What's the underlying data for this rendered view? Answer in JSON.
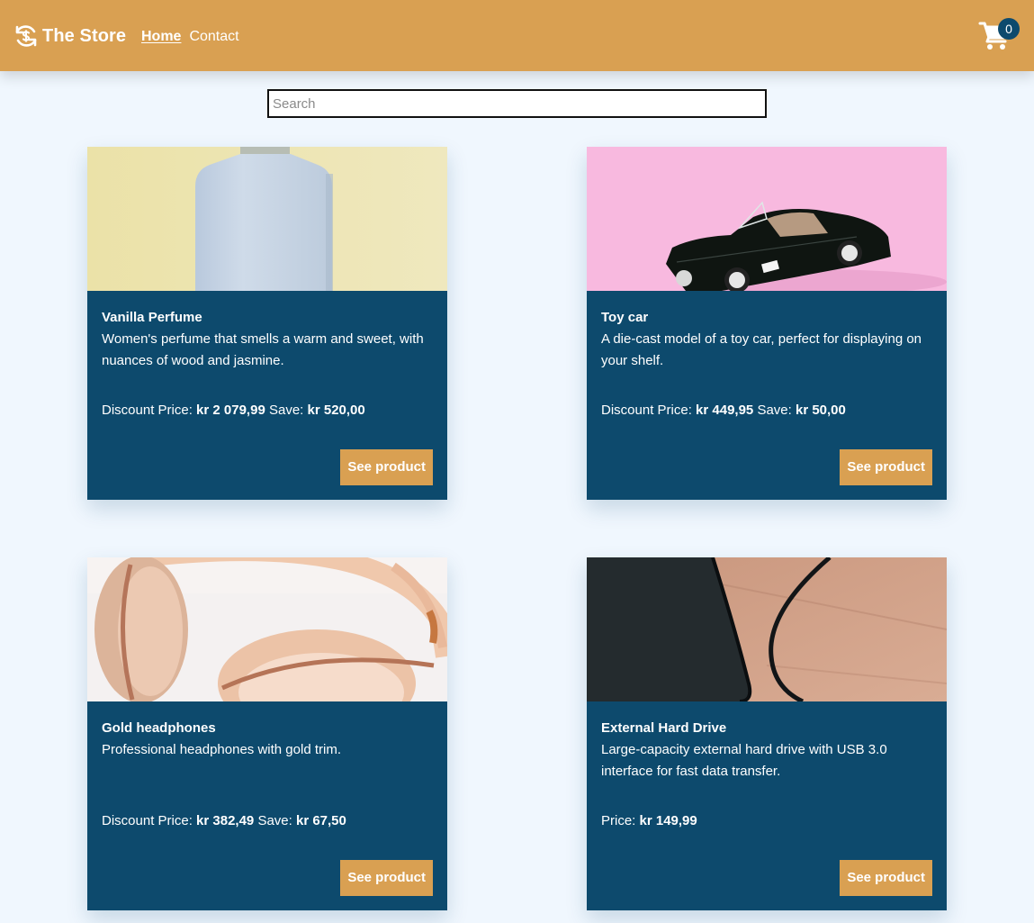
{
  "header": {
    "brand": "The Store",
    "nav": [
      {
        "label": "Home",
        "active": true
      },
      {
        "label": "Contact",
        "active": false
      }
    ],
    "cart_count": "0"
  },
  "search": {
    "placeholder": "Search",
    "value": ""
  },
  "products": [
    {
      "title": "Vanilla Perfume",
      "description": "Women's perfume that smells a warm and sweet, with nuances of wood and jasmine.",
      "price_label": "Discount Price:",
      "price": "kr 2 079,99",
      "save_label": "Save:",
      "save": "kr 520,00",
      "button": "See product",
      "image": "perfume-bottle"
    },
    {
      "title": "Toy car",
      "description": "A die-cast model of a toy car, perfect for displaying on your shelf.",
      "price_label": "Discount Price:",
      "price": "kr 449,95",
      "save_label": "Save:",
      "save": "kr 50,00",
      "button": "See product",
      "image": "toy-car"
    },
    {
      "title": "Gold headphones",
      "description": "Professional headphones with gold trim.",
      "price_label": "Discount Price:",
      "price": "kr 382,49",
      "save_label": "Save:",
      "save": "kr 67,50",
      "button": "See product",
      "image": "headphones"
    },
    {
      "title": "External Hard Drive",
      "description": "Large-capacity external hard drive with USB 3.0 interface for fast data transfer.",
      "price_label": "Price:",
      "price": "kr 149,99",
      "button": "See product",
      "image": "hard-drive"
    }
  ],
  "colors": {
    "header": "#d9a052",
    "card": "#0d4a6d",
    "background": "#f0f7fe",
    "button": "#d9a052"
  }
}
